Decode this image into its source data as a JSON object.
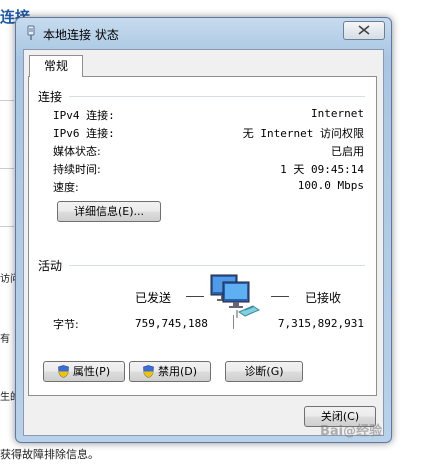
{
  "background": {
    "title": "连接",
    "fragments": [
      "访问的",
      "有",
      "生的"
    ],
    "footer": "获得故障排除信息。"
  },
  "dialog": {
    "title": "本地连接 状态",
    "tab": "常规",
    "connection": {
      "heading": "连接",
      "rows": [
        {
          "label": "IPv4 连接:",
          "value": "Internet"
        },
        {
          "label": "IPv6 连接:",
          "value": "无 Internet 访问权限"
        },
        {
          "label": "媒体状态:",
          "value": "已启用"
        },
        {
          "label": "持续时间:",
          "value": "1 天 09:45:14"
        },
        {
          "label": "速度:",
          "value": "100.0 Mbps"
        }
      ],
      "details_button": "详细信息(E)..."
    },
    "activity": {
      "heading": "活动",
      "sent_label": "已发送",
      "received_label": "已接收",
      "bytes_label": "字节:",
      "bytes_sent": "759,745,188",
      "bytes_received": "7,315,892,931"
    },
    "buttons": {
      "properties": "属性(P)",
      "disable": "禁用(D)",
      "diagnose": "诊断(G)",
      "close": "关闭(C)"
    }
  },
  "watermark": "Bai@经验"
}
